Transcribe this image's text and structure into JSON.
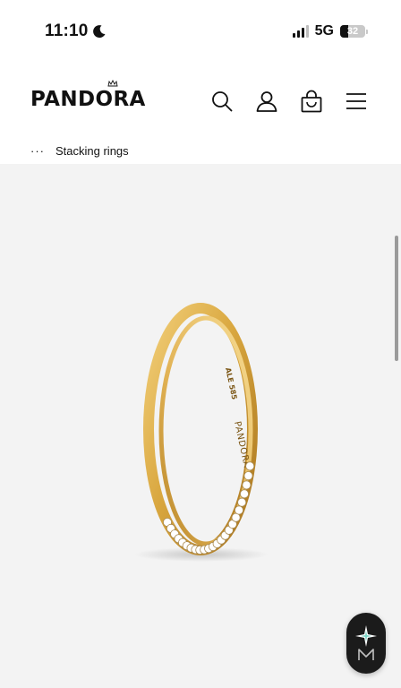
{
  "status_bar": {
    "time": "11:10",
    "network": "5G",
    "battery": "32",
    "battery_fraction": 0.32
  },
  "header": {
    "logo": "PANDORA",
    "icons": [
      "search-icon",
      "account-icon",
      "bag-icon",
      "menu-icon"
    ]
  },
  "breadcrumb": {
    "ellipsis": "···",
    "current": "Stacking rings"
  },
  "product": {
    "ring_engraving_inner": "ALE 585",
    "ring_engraving_brand": "PANDORA"
  },
  "colors": {
    "gold": "#d9a73f",
    "image_background": "#f3f3f3",
    "fab_background": "#1b1b1b",
    "fab_accent": "#7ed6c8"
  }
}
